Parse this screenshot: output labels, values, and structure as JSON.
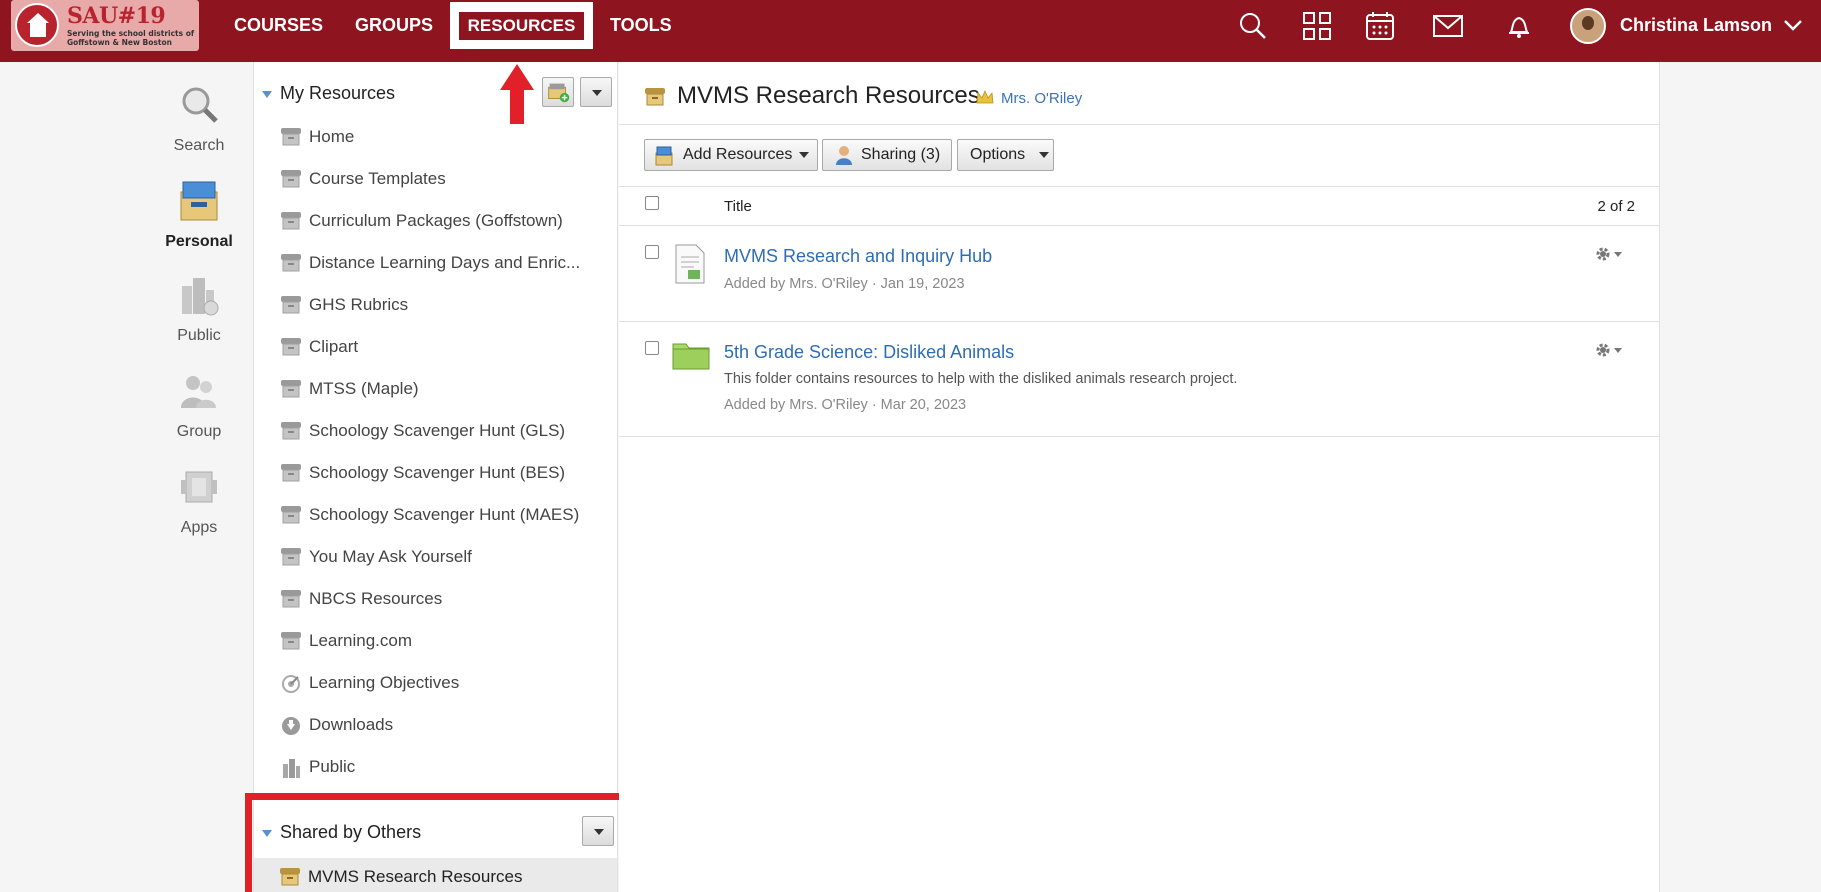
{
  "logo": {
    "brand": "SAU#19",
    "tagline": "Serving the school districts of Goffstown & New Boston"
  },
  "nav": {
    "courses": "COURSES",
    "groups": "GROUPS",
    "resources": "RESOURCES",
    "tools": "TOOLS"
  },
  "user": {
    "name": "Christina Lamson"
  },
  "leftbar": {
    "items": [
      {
        "label": "Search"
      },
      {
        "label": "Personal"
      },
      {
        "label": "Public"
      },
      {
        "label": "Group"
      },
      {
        "label": "Apps"
      }
    ]
  },
  "my_resources": {
    "heading": "My Resources",
    "items": [
      {
        "label": "Home"
      },
      {
        "label": "Course Templates"
      },
      {
        "label": "Curriculum Packages (Goffstown)"
      },
      {
        "label": "Distance Learning Days and Enric..."
      },
      {
        "label": "GHS Rubrics"
      },
      {
        "label": "Clipart"
      },
      {
        "label": "MTSS (Maple)"
      },
      {
        "label": "Schoology Scavenger Hunt (GLS)"
      },
      {
        "label": "Schoology Scavenger Hunt (BES)"
      },
      {
        "label": "Schoology Scavenger Hunt (MAES)"
      },
      {
        "label": "You May Ask Yourself"
      },
      {
        "label": "NBCS Resources"
      },
      {
        "label": "Learning.com"
      },
      {
        "label": "Learning Objectives"
      },
      {
        "label": "Downloads"
      },
      {
        "label": "Public"
      }
    ]
  },
  "shared": {
    "heading": "Shared by Others",
    "items": [
      {
        "label": "MVMS Research Resources"
      }
    ]
  },
  "main": {
    "title": "MVMS Research Resources",
    "owner": "Mrs. O'Riley",
    "toolbar": {
      "add": "Add Resources",
      "sharing": "Sharing (3)",
      "options": "Options"
    },
    "table": {
      "column_title": "Title",
      "count": "2 of 2",
      "rows": [
        {
          "title": "MVMS Research and Inquiry Hub",
          "description": "",
          "meta": "Added by Mrs. O'Riley · Jan 19, 2023"
        },
        {
          "title": "5th Grade Science: Disliked Animals",
          "description": "This folder contains resources to help with the disliked animals research project.",
          "meta": "Added by Mrs. O'Riley · Mar 20, 2023"
        }
      ]
    }
  },
  "colors": {
    "brand": "#8e1420",
    "link": "#2e6db5",
    "highlight": "#e2202a"
  }
}
